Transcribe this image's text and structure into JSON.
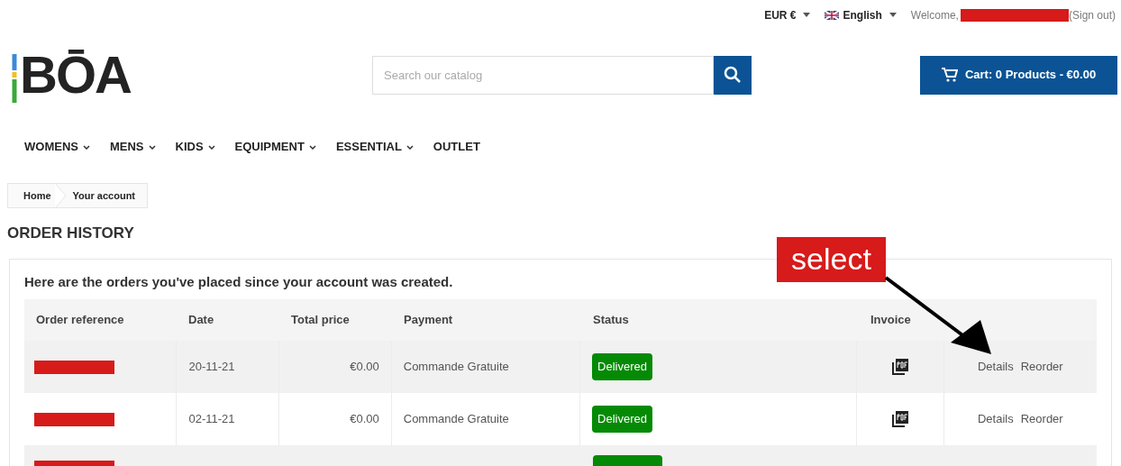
{
  "top_bar": {
    "currency": "EUR €",
    "language": "English",
    "welcome": "Welcome,",
    "sign_out": "(Sign out)"
  },
  "header": {
    "logo": "BŌA",
    "search": {
      "placeholder": "Search our catalog"
    },
    "cart": "Cart: 0 Products - €0.00"
  },
  "nav": [
    {
      "label": "WOMENS",
      "dropdown": true
    },
    {
      "label": "MENS",
      "dropdown": true
    },
    {
      "label": "KIDS",
      "dropdown": true
    },
    {
      "label": "EQUIPMENT",
      "dropdown": true
    },
    {
      "label": "ESSENTIAL",
      "dropdown": true
    },
    {
      "label": "OUTLET",
      "dropdown": false
    }
  ],
  "breadcrumb": [
    "Home",
    "Your account"
  ],
  "page_title": "ORDER HISTORY",
  "intro": "Here are the orders you've placed since your account was created.",
  "table": {
    "columns": [
      "Order reference",
      "Date",
      "Total price",
      "Payment",
      "Status",
      "Invoice"
    ],
    "rows": [
      {
        "cut_off": false,
        "date": "20-11-21",
        "total": "€0.00",
        "payment": "Commande Gratuite",
        "status": "Delivered",
        "actions": [
          "Details",
          "Reorder"
        ]
      },
      {
        "cut_off": false,
        "date": "02-11-21",
        "total": "€0.00",
        "payment": "Commande Gratuite",
        "status": "Delivered",
        "actions": [
          "Details",
          "Reorder"
        ]
      },
      {
        "cut_off": true
      }
    ]
  },
  "annotation": {
    "label": "select"
  }
}
